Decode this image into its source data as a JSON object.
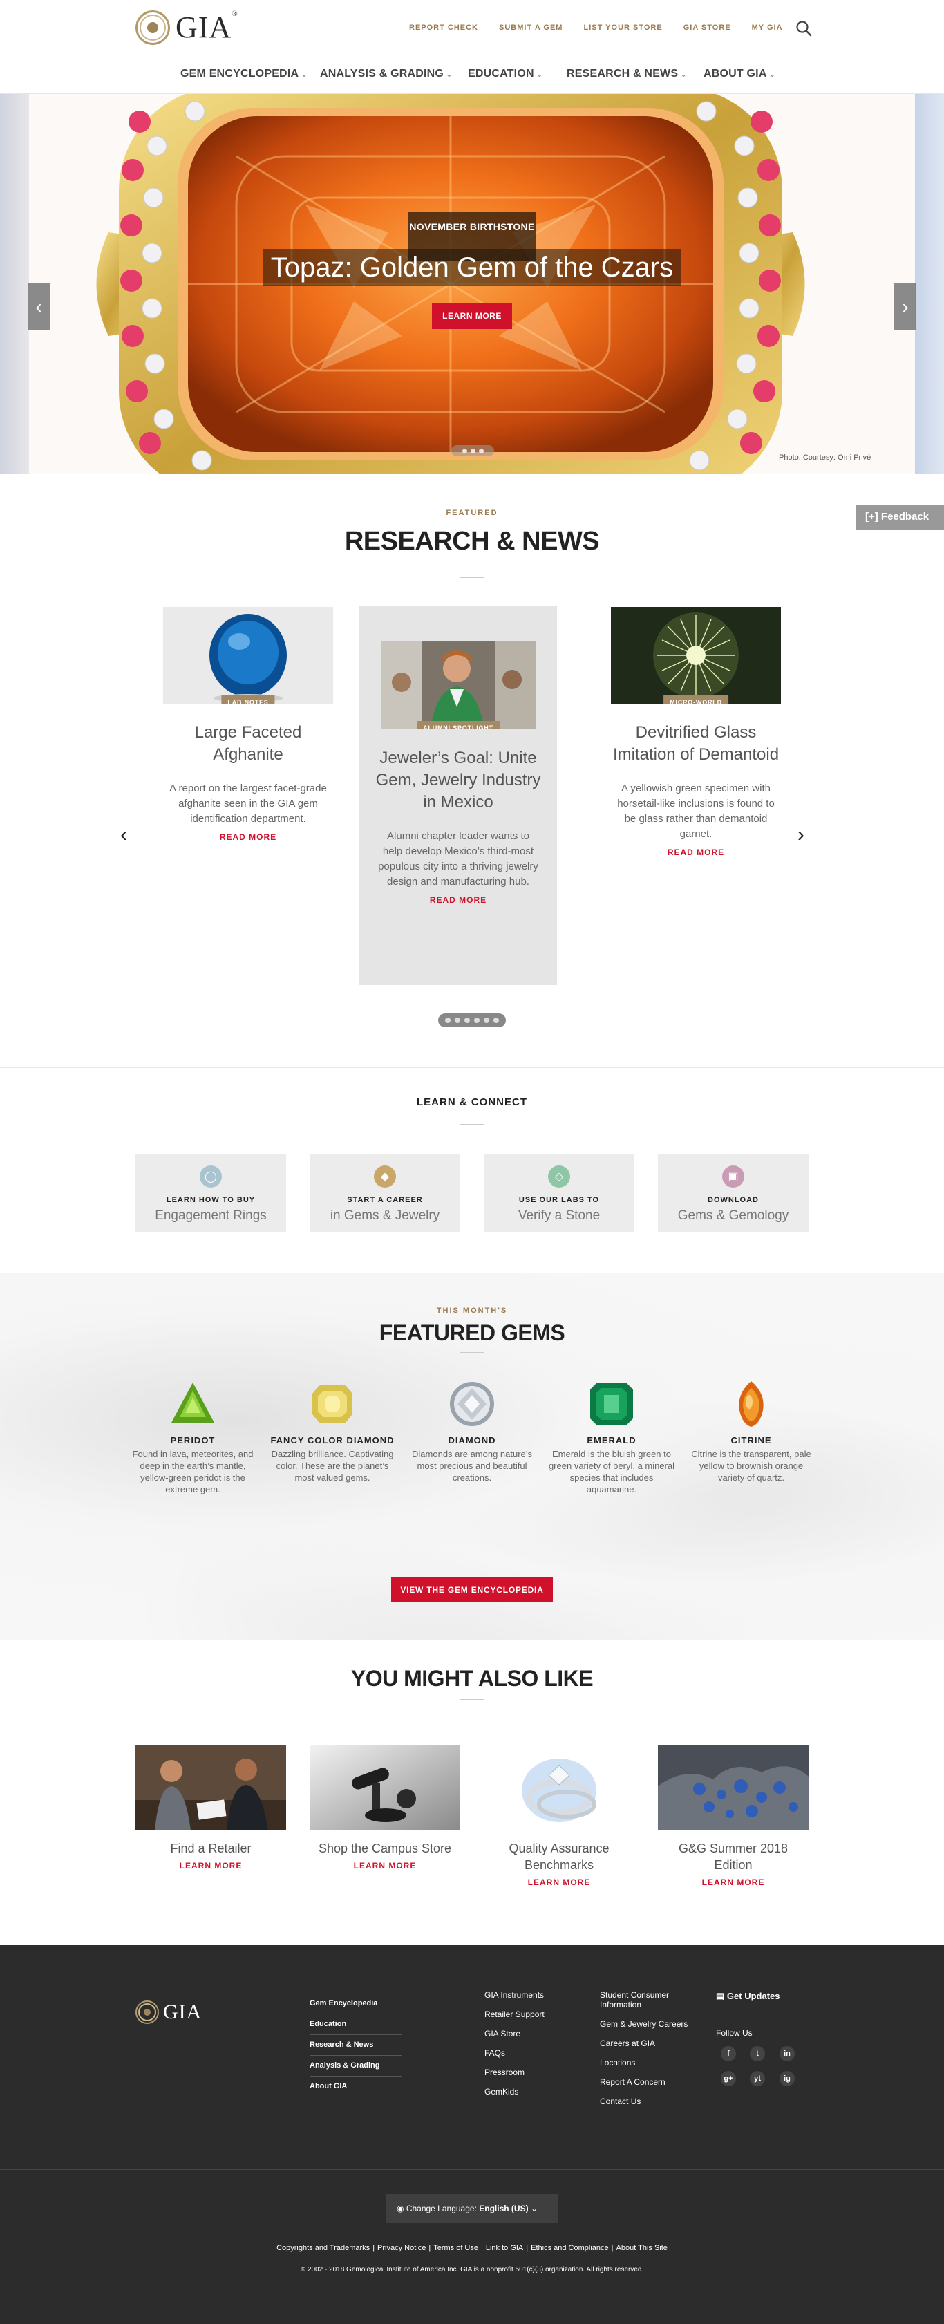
{
  "brand": {
    "name": "GIA",
    "trademark": "®"
  },
  "utility_nav": [
    "REPORT CHECK",
    "SUBMIT A GEM",
    "LIST YOUR STORE",
    "GIA STORE",
    "MY GIA"
  ],
  "main_nav": [
    "GEM ENCYCLOPEDIA",
    "ANALYSIS & GRADING",
    "EDUCATION",
    "RESEARCH & NEWS",
    "ABOUT GIA"
  ],
  "hero": {
    "kicker": "NOVEMBER BIRTHSTONE",
    "title": "Topaz: Golden Gem of the Czars",
    "button": "LEARN MORE",
    "credit": "Photo: Courtesy: Omi Privé",
    "prev": "‹",
    "next": "›"
  },
  "feedback": "Feedback",
  "research": {
    "kicker": "FEATURED",
    "title": "RESEARCH & NEWS",
    "cards": [
      {
        "tag": "LAB NOTES",
        "title": "Large Faceted Afghanite",
        "text": "A report on the largest facet-grade afghanite seen in the GIA gem identification department.",
        "more": "READ MORE"
      },
      {
        "tag": "ALUMNI SPOTLIGHT",
        "title": "Jeweler’s Goal: Unite Gem, Jewelry Industry in Mexico",
        "text": "Alumni chapter leader wants to help develop Mexico’s third-most populous city into a thriving jewelry design and manufacturing hub.",
        "more": "READ MORE"
      },
      {
        "tag": "MICRO-WORLD",
        "title": "Devitrified Glass Imitation of Demantoid",
        "text": "A yellowish green specimen with horsetail-like inclusions is found to be glass rather than demantoid garnet.",
        "more": "READ MORE"
      }
    ],
    "prev": "‹",
    "next": "›"
  },
  "learn": {
    "title": "LEARN & CONNECT",
    "items": [
      {
        "t1": "LEARN HOW TO BUY",
        "t2": "Engagement Rings",
        "color": "#a9c4cf"
      },
      {
        "t1": "START A CAREER",
        "t2": "in Gems & Jewelry",
        "color": "#c9a76a"
      },
      {
        "t1": "USE OUR LABS TO",
        "t2": "Verify a Stone",
        "color": "#8fc6a6"
      },
      {
        "t1": "DOWNLOAD",
        "t2": "Gems & Gemology",
        "color": "#c99bb4"
      }
    ]
  },
  "gems": {
    "kicker": "THIS MONTH'S",
    "title": "FEATURED GEMS",
    "items": [
      {
        "name": "PERIDOT",
        "text": "Found in lava, meteorites, and deep in the earth’s mantle, yellow-green peridot is the extreme gem."
      },
      {
        "name": "FANCY COLOR DIAMOND",
        "text": "Dazzling brilliance. Captivating color. These are the planet’s most valued gems."
      },
      {
        "name": "DIAMOND",
        "text": "Diamonds are among nature’s most precious and beautiful creations."
      },
      {
        "name": "EMERALD",
        "text": "Emerald is the bluish green to green variety of beryl, a mineral species that includes aquamarine."
      },
      {
        "name": "CITRINE",
        "text": "Citrine is the transparent, pale yellow to brownish orange variety of quartz."
      }
    ],
    "button": "VIEW THE GEM ENCYCLOPEDIA"
  },
  "like": {
    "title": "YOU MIGHT ALSO LIKE",
    "items": [
      {
        "title": "Find a Retailer",
        "more": "LEARN MORE"
      },
      {
        "title": "Shop the Campus Store",
        "more": "LEARN MORE"
      },
      {
        "title": "Quality Assurance Benchmarks",
        "more": "LEARN MORE"
      },
      {
        "title": "G&G Summer 2018 Edition",
        "more": "LEARN MORE"
      }
    ]
  },
  "footer": {
    "col1": [
      "Gem Encyclopedia",
      "Education",
      "Research & News",
      "Analysis & Grading",
      "About GIA"
    ],
    "col2": [
      "GIA Instruments",
      "Retailer Support",
      "GIA Store",
      "FAQs",
      "Pressroom",
      "GemKids"
    ],
    "col3": [
      "Student Consumer Information",
      "Gem & Jewelry Careers",
      "Careers at GIA",
      "Locations",
      "Report A Concern",
      "Contact Us"
    ],
    "updates": "Get Updates",
    "follow": "Follow Us",
    "social": [
      "f",
      "t",
      "in",
      "g+",
      "yt",
      "ig"
    ],
    "language_label": "Change Language:",
    "language_value": "English (US)",
    "links": [
      "Copyrights and Trademarks",
      "Privacy Notice",
      "Terms of Use",
      "Link to GIA",
      "Ethics and Compliance",
      "About This Site"
    ],
    "copyright": "© 2002 - 2018 Gemological Institute of America Inc. GIA is a nonprofit 501(c)(3) organization. All rights reserved."
  }
}
